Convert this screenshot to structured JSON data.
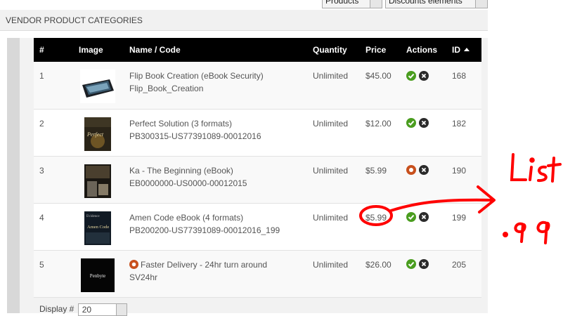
{
  "top_selects": [
    {
      "label": "Products"
    },
    {
      "label": "Discounts elements"
    }
  ],
  "panel": {
    "title": "VENDOR PRODUCT CATEGORIES"
  },
  "table": {
    "columns": [
      "#",
      "Image",
      "Name / Code",
      "Quantity",
      "Price",
      "Actions",
      "ID"
    ],
    "sort_column": "ID",
    "rows": [
      {
        "num": "1",
        "name": "Flip Book Creation (eBook Security)",
        "code": "Flip_Book_Creation",
        "quantity": "Unlimited",
        "price": "$45.00",
        "status": "published",
        "id": "168"
      },
      {
        "num": "2",
        "name": "Perfect Solution (3 formats)",
        "code": "PB300315-US77391089-00012016",
        "quantity": "Unlimited",
        "price": "$12.00",
        "status": "published",
        "id": "182"
      },
      {
        "num": "3",
        "name": "Ka - The Beginning (eBook)",
        "code": "EB0000000-US0000-00012015",
        "quantity": "Unlimited",
        "price": "$5.99",
        "status": "unpublished",
        "id": "190"
      },
      {
        "num": "4",
        "name": "Amen Code eBook (4 formats)",
        "code": "PB200200-US77391089-00012016_199",
        "quantity": "Unlimited",
        "price": "$5.99",
        "status": "published",
        "id": "199"
      },
      {
        "num": "5",
        "name": "Faster Delivery - 24hr turn around",
        "code": "SV24hr",
        "quantity": "Unlimited",
        "price": "$26.00",
        "status": "published",
        "id": "205"
      }
    ],
    "thumb_texts": {
      "row2": "Perfect",
      "row4_title": "Amen Code",
      "row4_top": "Evidence",
      "row5": "Penbyte"
    }
  },
  "footer": {
    "display_label": "Display #",
    "display_value": "20"
  },
  "annotation": {
    "text": "List .99",
    "color": "#ff0000"
  },
  "colors": {
    "header_bg": "#000000",
    "publish_green": "#4a9d1f",
    "unpublish_orange": "#c8501d"
  }
}
